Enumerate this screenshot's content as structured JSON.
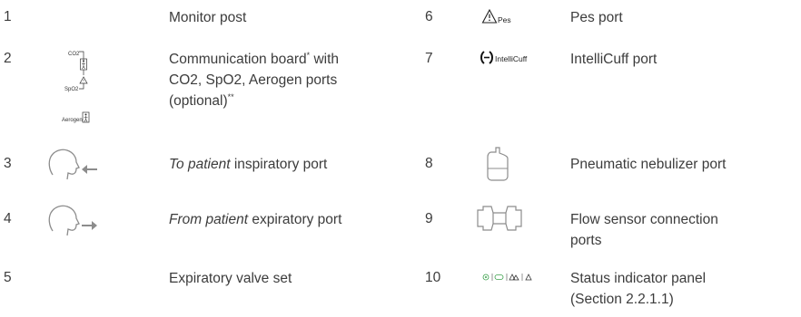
{
  "rows": [
    {
      "n": "1",
      "text": "Monitor post"
    },
    {
      "n": "2",
      "line1": "Communication board",
      "sup1": "*",
      "line1b": " with",
      "line2": "CO2, SpO2, Aerogen ports",
      "line3": "(optional)",
      "sup3": "**"
    },
    {
      "n": "3",
      "italic": "To patient",
      "text": " inspiratory port"
    },
    {
      "n": "4",
      "italic": "From patient",
      "text": " expiratory port"
    },
    {
      "n": "5",
      "text": "Expiratory valve set"
    },
    {
      "n": "6",
      "text": "Pes port",
      "icon_label": "Pes"
    },
    {
      "n": "7",
      "text": "IntelliCuff port",
      "icon_label": "IntelliCuff"
    },
    {
      "n": "8",
      "text": "Pneumatic nebulizer port"
    },
    {
      "n": "9",
      "line1": "Flow sensor connection",
      "line2": "ports"
    },
    {
      "n": "10",
      "line1": "Status indicator panel",
      "line2": "(Section 2.2.1.1)"
    }
  ],
  "icon_labels": {
    "co2": "CO2",
    "spo2": "SpO2",
    "aerogen": "Aerogen"
  },
  "colors": {
    "text": "#3c3c3c",
    "icon": "#8c8c8c",
    "green": "#3aa04a"
  }
}
